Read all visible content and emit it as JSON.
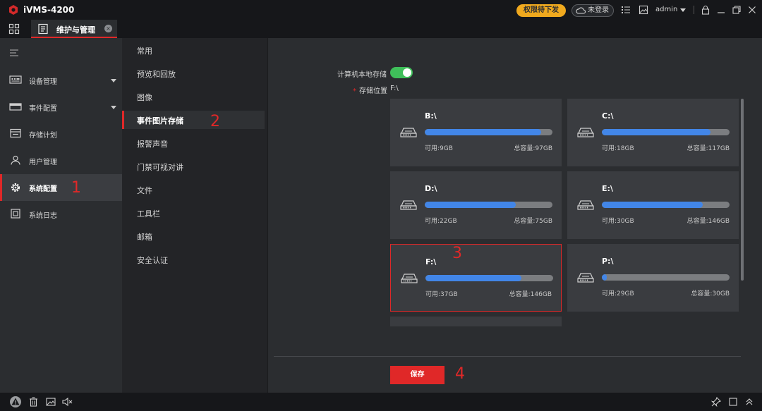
{
  "app": {
    "title": "iVMS-4200",
    "permission_badge": "权限待下发",
    "login_status": "未登录",
    "username": "admin"
  },
  "tab": {
    "label": "维护与管理"
  },
  "sidebar": {
    "items": [
      {
        "label": "设备管理",
        "has_caret": true
      },
      {
        "label": "事件配置",
        "has_caret": true
      },
      {
        "label": "存储计划",
        "has_caret": false
      },
      {
        "label": "用户管理",
        "has_caret": false
      },
      {
        "label": "系统配置",
        "has_caret": false,
        "active": true
      },
      {
        "label": "系统日志",
        "has_caret": false
      }
    ]
  },
  "submenu": {
    "items": [
      "常用",
      "预览和回放",
      "图像",
      "事件图片存储",
      "报警声音",
      "门禁可视对讲",
      "文件",
      "工具栏",
      "邮箱",
      "安全认证"
    ],
    "active_index": 3
  },
  "form": {
    "local_storage_label": "计算机本地存储",
    "local_storage_enabled": true,
    "location_label": "存储位置",
    "location_value": "F:\\"
  },
  "drives": [
    {
      "name": "B:\\",
      "available": "可用:9GB",
      "total": "总容量:97GB",
      "used_fraction": 0.91
    },
    {
      "name": "C:\\",
      "available": "可用:18GB",
      "total": "总容量:117GB",
      "used_fraction": 0.85
    },
    {
      "name": "D:\\",
      "available": "可用:22GB",
      "total": "总容量:75GB",
      "used_fraction": 0.71
    },
    {
      "name": "E:\\",
      "available": "可用:30GB",
      "total": "总容量:146GB",
      "used_fraction": 0.79
    },
    {
      "name": "F:\\",
      "available": "可用:37GB",
      "total": "总容量:146GB",
      "used_fraction": 0.75,
      "selected": true
    },
    {
      "name": "P:\\",
      "available": "可用:29GB",
      "total": "总容量:30GB",
      "used_fraction": 0.04
    }
  ],
  "actions": {
    "save_label": "保存"
  },
  "annotations": [
    "1",
    "2",
    "3",
    "4"
  ],
  "colors": {
    "accent": "#e02828",
    "progress": "#4286e8",
    "toggle_on": "#3fbf5a",
    "badge": "#f0a91e"
  }
}
